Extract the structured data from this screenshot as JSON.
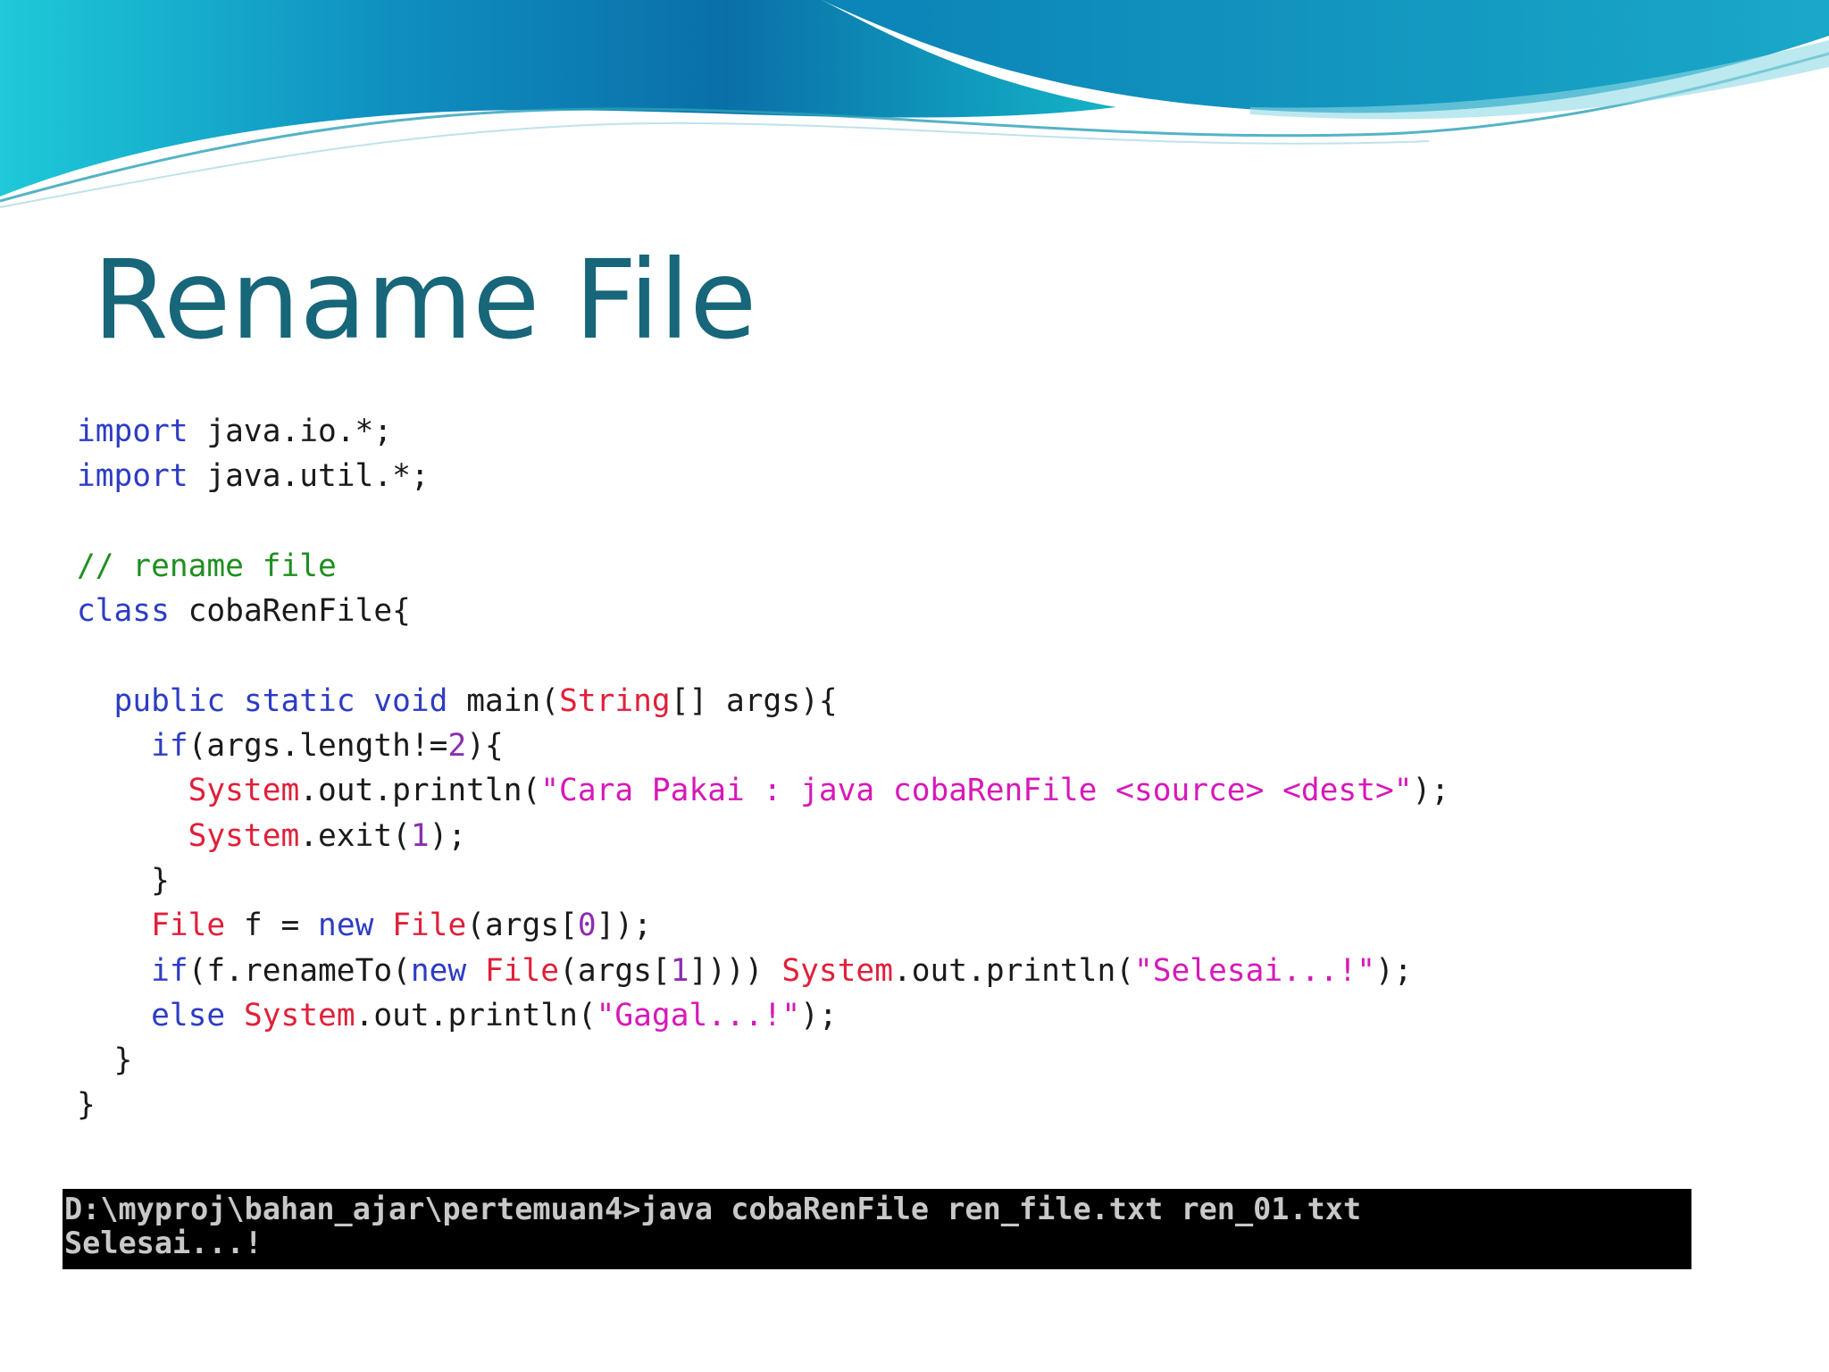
{
  "slide": {
    "title": "Rename File"
  },
  "colors": {
    "title": "#17667a",
    "keyword": "#2d3cc4",
    "type": "#e0203a",
    "string": "#d619b8",
    "number": "#8a2fb0",
    "comment": "#1f8f1f",
    "plain": "#1a1a1a",
    "terminal_bg": "#000000",
    "terminal_text": "#c8c8c8",
    "wave_teal": "#14b4c8",
    "wave_blue": "#0a6fa8"
  },
  "code": {
    "lines": [
      {
        "indent": 0,
        "tokens": [
          {
            "t": "kw",
            "v": "import"
          },
          {
            "t": "plain",
            "v": " java.io.*;"
          }
        ]
      },
      {
        "indent": 0,
        "tokens": [
          {
            "t": "kw",
            "v": "import"
          },
          {
            "t": "plain",
            "v": " java.util.*;"
          }
        ]
      },
      {
        "indent": 0,
        "tokens": []
      },
      {
        "indent": 0,
        "tokens": [
          {
            "t": "cmt",
            "v": "// rename file"
          }
        ]
      },
      {
        "indent": 0,
        "tokens": [
          {
            "t": "kw",
            "v": "class"
          },
          {
            "t": "plain",
            "v": " cobaRenFile{"
          }
        ]
      },
      {
        "indent": 0,
        "tokens": []
      },
      {
        "indent": 2,
        "tokens": [
          {
            "t": "kw",
            "v": "public"
          },
          {
            "t": "plain",
            "v": " "
          },
          {
            "t": "kw",
            "v": "static"
          },
          {
            "t": "plain",
            "v": " "
          },
          {
            "t": "kw",
            "v": "void"
          },
          {
            "t": "plain",
            "v": " main("
          },
          {
            "t": "type",
            "v": "String"
          },
          {
            "t": "plain",
            "v": "[] args){"
          }
        ]
      },
      {
        "indent": 4,
        "tokens": [
          {
            "t": "kw",
            "v": "if"
          },
          {
            "t": "plain",
            "v": "(args.length!="
          },
          {
            "t": "num",
            "v": "2"
          },
          {
            "t": "plain",
            "v": "){"
          }
        ]
      },
      {
        "indent": 6,
        "tokens": [
          {
            "t": "type",
            "v": "System"
          },
          {
            "t": "plain",
            "v": ".out.println("
          },
          {
            "t": "str",
            "v": "\"Cara Pakai : java cobaRenFile <source> <dest>\""
          },
          {
            "t": "plain",
            "v": ");"
          }
        ]
      },
      {
        "indent": 6,
        "tokens": [
          {
            "t": "type",
            "v": "System"
          },
          {
            "t": "plain",
            "v": ".exit("
          },
          {
            "t": "num",
            "v": "1"
          },
          {
            "t": "plain",
            "v": ");"
          }
        ]
      },
      {
        "indent": 4,
        "tokens": [
          {
            "t": "plain",
            "v": "}"
          }
        ]
      },
      {
        "indent": 4,
        "tokens": [
          {
            "t": "type",
            "v": "File"
          },
          {
            "t": "plain",
            "v": " f = "
          },
          {
            "t": "kw",
            "v": "new"
          },
          {
            "t": "plain",
            "v": " "
          },
          {
            "t": "type",
            "v": "File"
          },
          {
            "t": "plain",
            "v": "(args["
          },
          {
            "t": "num",
            "v": "0"
          },
          {
            "t": "plain",
            "v": "]);"
          }
        ]
      },
      {
        "indent": 4,
        "tokens": [
          {
            "t": "kw",
            "v": "if"
          },
          {
            "t": "plain",
            "v": "(f.renameTo("
          },
          {
            "t": "kw",
            "v": "new"
          },
          {
            "t": "plain",
            "v": " "
          },
          {
            "t": "type",
            "v": "File"
          },
          {
            "t": "plain",
            "v": "(args["
          },
          {
            "t": "num",
            "v": "1"
          },
          {
            "t": "plain",
            "v": "]))) "
          },
          {
            "t": "type",
            "v": "System"
          },
          {
            "t": "plain",
            "v": ".out.println("
          },
          {
            "t": "str",
            "v": "\"Selesai...!\""
          },
          {
            "t": "plain",
            "v": ");"
          }
        ]
      },
      {
        "indent": 4,
        "tokens": [
          {
            "t": "kw",
            "v": "else"
          },
          {
            "t": "plain",
            "v": " "
          },
          {
            "t": "type",
            "v": "System"
          },
          {
            "t": "plain",
            "v": ".out.println("
          },
          {
            "t": "str",
            "v": "\"Gagal...!\""
          },
          {
            "t": "plain",
            "v": ");"
          }
        ]
      },
      {
        "indent": 2,
        "tokens": [
          {
            "t": "plain",
            "v": "}"
          }
        ]
      },
      {
        "indent": 0,
        "tokens": [
          {
            "t": "plain",
            "v": "}"
          }
        ]
      }
    ]
  },
  "terminal": {
    "command_line": "D:\\myproj\\bahan_ajar\\pertemuan4>java cobaRenFile ren_file.txt ren_01.txt",
    "output_line": "Selesai...!"
  }
}
